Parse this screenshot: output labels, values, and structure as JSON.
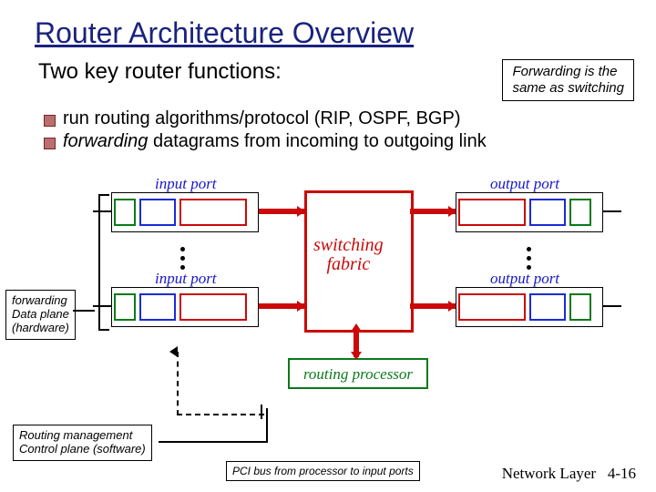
{
  "title": "Router Architecture Overview",
  "subtitle": "Two key router functions:",
  "note": "Forwarding  is the\nsame as switching",
  "bullets": {
    "b1_pre": "run routing algorithms/protocol (RIP, OSPF, BGP)",
    "b2_em": "forwarding",
    "b2_rest": " datagrams from incoming to outgoing link"
  },
  "labels": {
    "input_port": "input port",
    "output_port": "output port",
    "switching": "switching\nfabric",
    "routing": "routing processor"
  },
  "side": {
    "forwarding": "forwarding\nData plane\n(hardware)",
    "routing_mgmt": "Routing management\nControl plane (software)"
  },
  "pci": "PCI bus  from processor to input ports",
  "footer": {
    "section": "Network Layer",
    "page": "4-16"
  }
}
